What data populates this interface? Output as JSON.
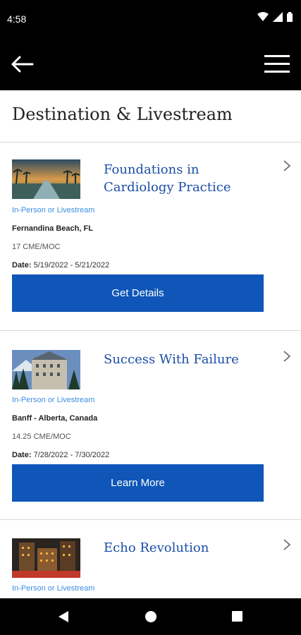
{
  "status_bar": {
    "time": "4:58"
  },
  "icons": {
    "back": "arrow-left-icon",
    "menu": "hamburger-menu-icon",
    "chevron": "chevron-right-icon",
    "wifi": "wifi-icon",
    "signal": "signal-icon",
    "battery": "battery-icon"
  },
  "header": {
    "title": "Destination & Livestream"
  },
  "events": [
    {
      "title": "Foundations in Cardiology Practice",
      "format": "In-Person or Livestream",
      "location": "Fernandina Beach, FL",
      "credits": "17 CME/MOC",
      "date_label": "Date:",
      "date": "5/19/2022 - 5/21/2022",
      "button": "Get Details"
    },
    {
      "title": "Success With Failure",
      "format": "In-Person or Livestream",
      "location": "Banff - Alberta, Canada",
      "credits": "14.25 CME/MOC",
      "date_label": "Date:",
      "date": "7/28/2022 - 7/30/2022",
      "button": "Learn More"
    },
    {
      "title": "Echo Revolution",
      "format": "In-Person or Livestream"
    }
  ],
  "colors": {
    "accent": "#0f56b8",
    "title_blue": "#1b4ea6",
    "format_blue": "#3d8de0"
  }
}
